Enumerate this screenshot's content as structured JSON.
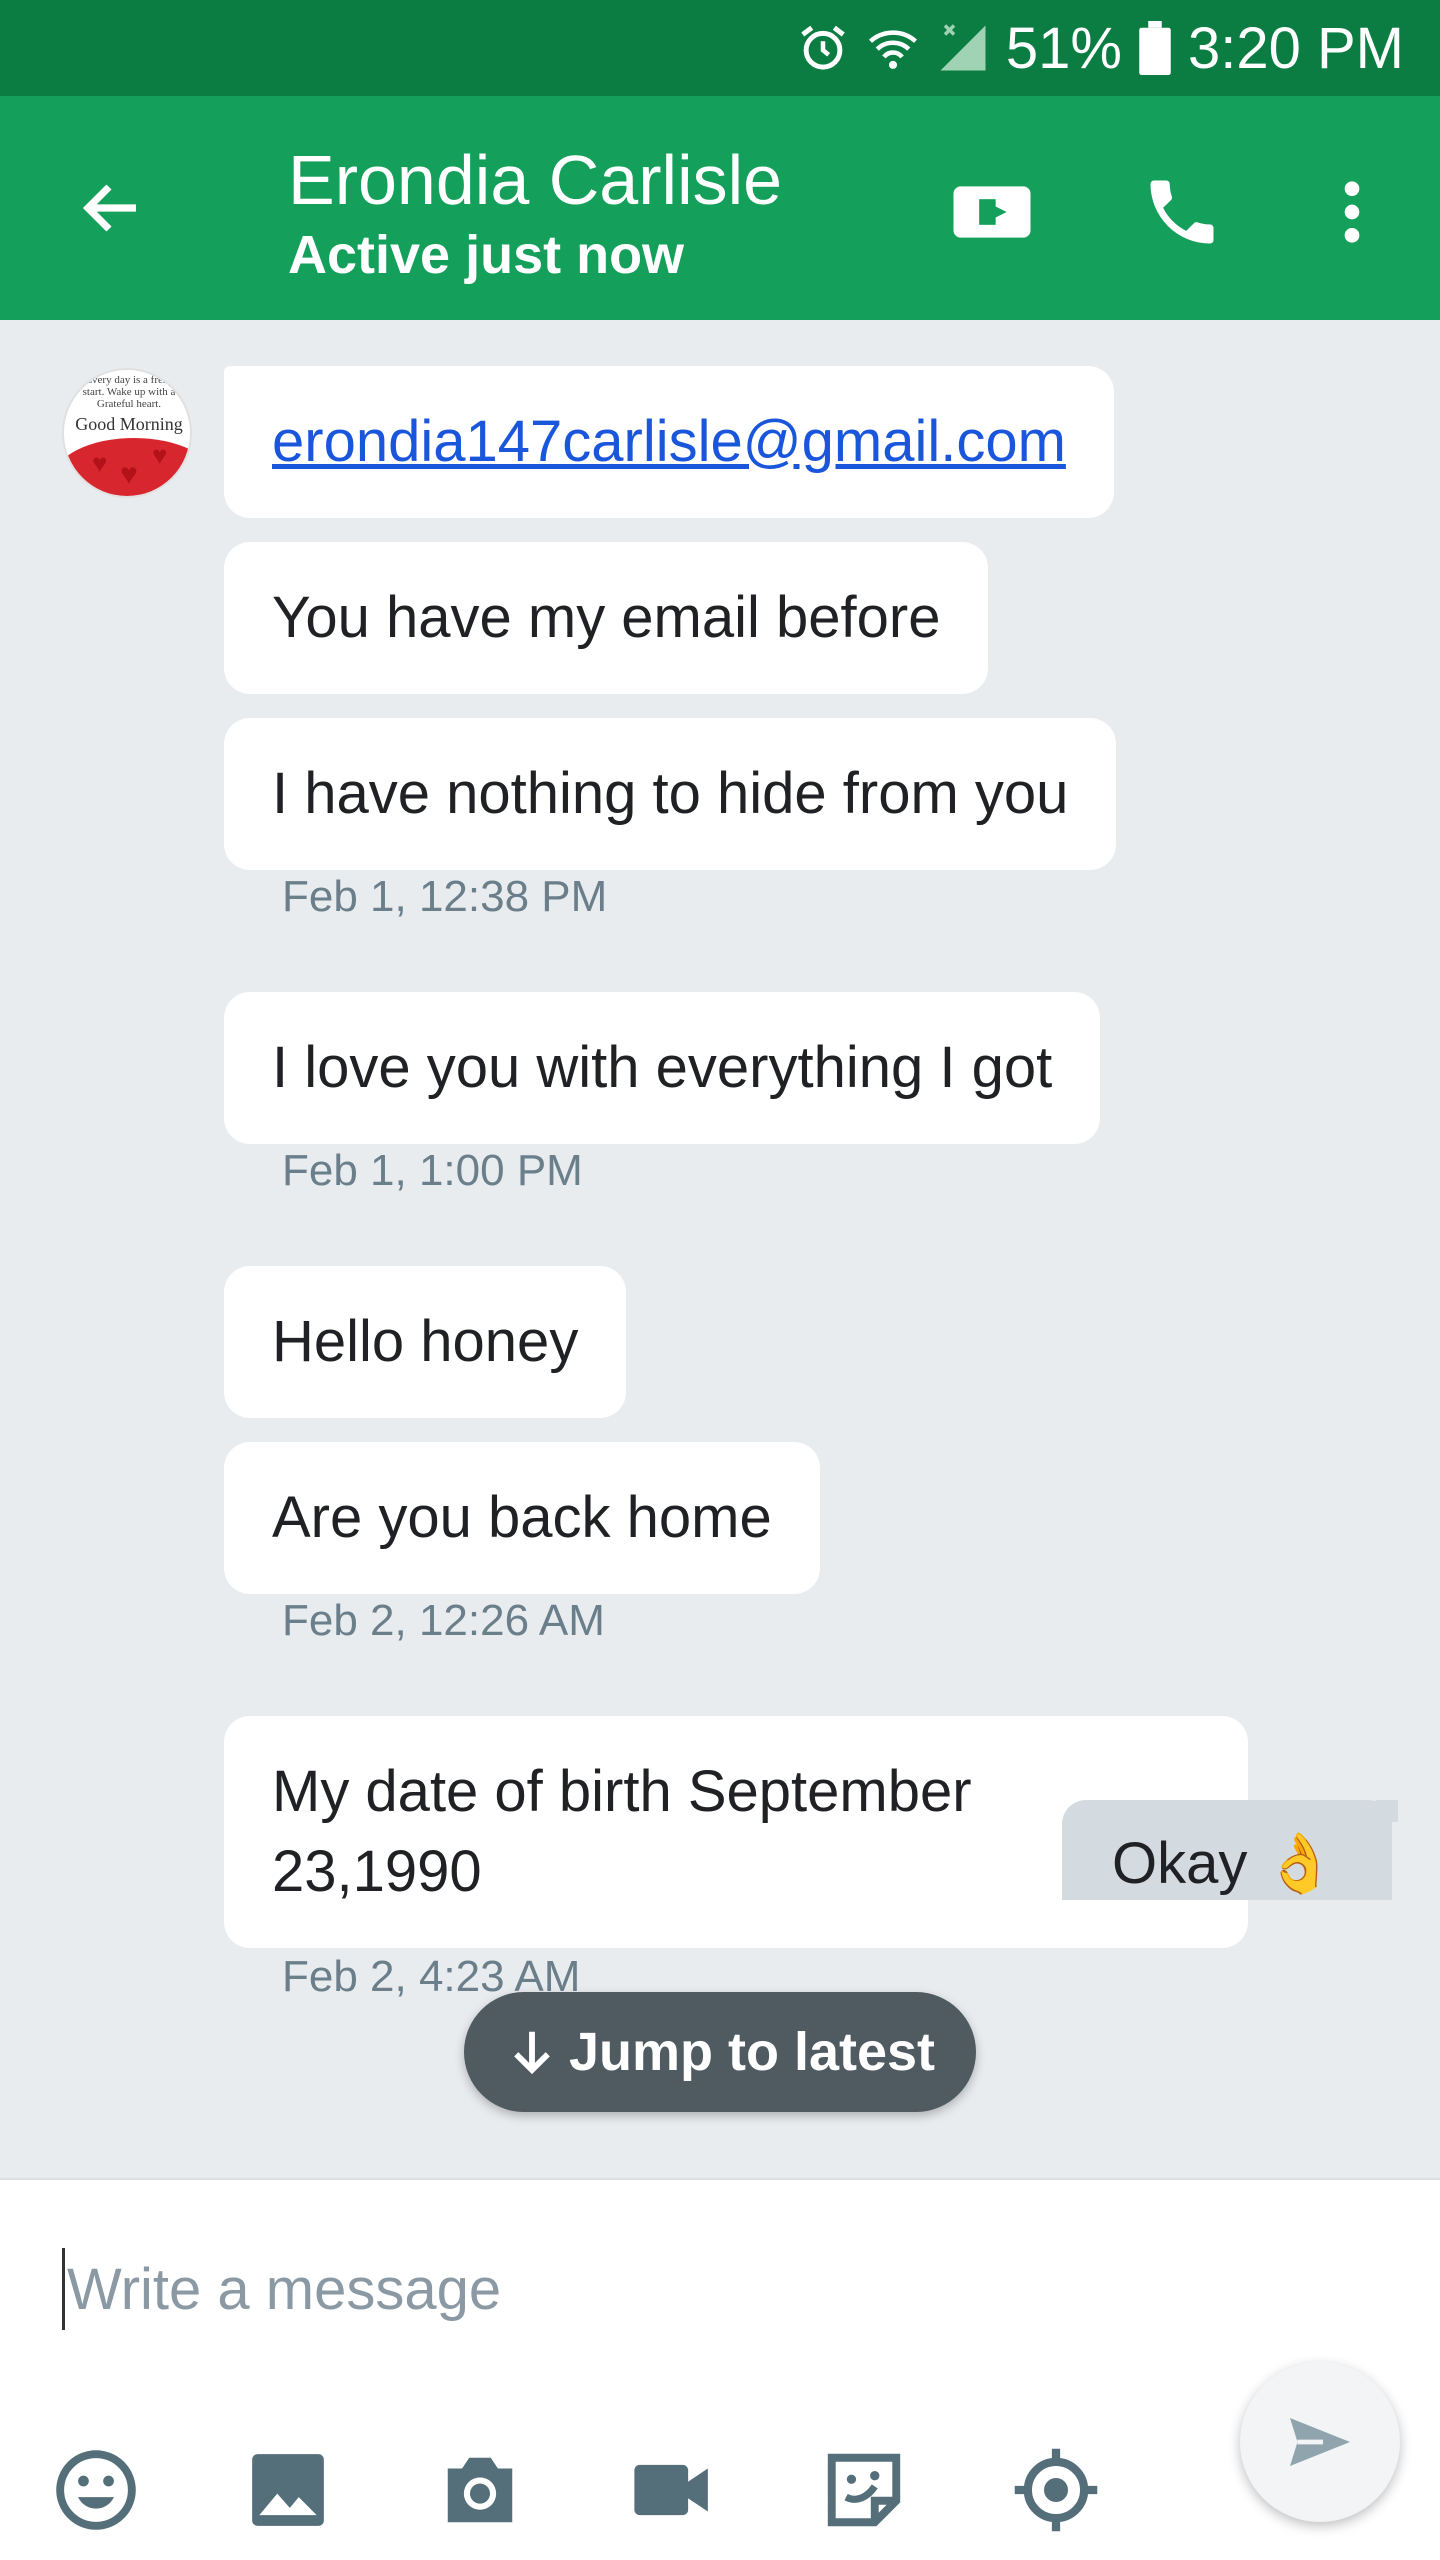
{
  "status_bar": {
    "battery": "51%",
    "time": "3:20 PM",
    "icons": [
      "alarm-icon",
      "wifi-icon",
      "signal-icon",
      "battery-icon"
    ]
  },
  "header": {
    "contact_name": "Erondia Carlisle",
    "presence": "Active just now",
    "icons": [
      "back-arrow-icon",
      "video-call-icon",
      "phone-icon",
      "more-vert-icon"
    ]
  },
  "avatar": {
    "text_small": "Every day is a fresh start. Wake up with a Grateful heart.",
    "text_large": "Good Morning"
  },
  "messages": [
    {
      "text": "erondia147carlisle@gmail.com",
      "type": "link"
    },
    {
      "text": "You have my email before"
    },
    {
      "text": "I have nothing to hide from you"
    },
    {
      "text": "I love you with everything I got"
    },
    {
      "text": "Hello honey"
    },
    {
      "text": "Are you back home"
    },
    {
      "text": "My date of birth September",
      "text2": "23,1990"
    }
  ],
  "timestamps": [
    "Feb 1, 12:38 PM",
    "Feb 1, 1:00 PM",
    "Feb 2, 12:26 AM",
    "Feb 2, 4:23 AM"
  ],
  "outgoing": {
    "text": "Okay",
    "emoji": "👌"
  },
  "jump_button": {
    "label": "Jump to latest",
    "icon": "arrow-down-icon"
  },
  "composer": {
    "placeholder": "Write a message",
    "tools": [
      "emoji-icon",
      "image-icon",
      "camera-icon",
      "video-icon",
      "sticker-icon",
      "location-icon"
    ],
    "send_icon": "send-icon"
  },
  "colors": {
    "status_bar": "#0b7d43",
    "app_bar": "#14a05a",
    "chat_bg": "#e9ecef",
    "bubble": "#ffffff",
    "outgoing_bubble": "#d3dbe0",
    "link": "#1a56db",
    "timestamp": "#6b7f8b",
    "jump_button": "#4f5b61",
    "tool_icon": "#546e7a"
  }
}
